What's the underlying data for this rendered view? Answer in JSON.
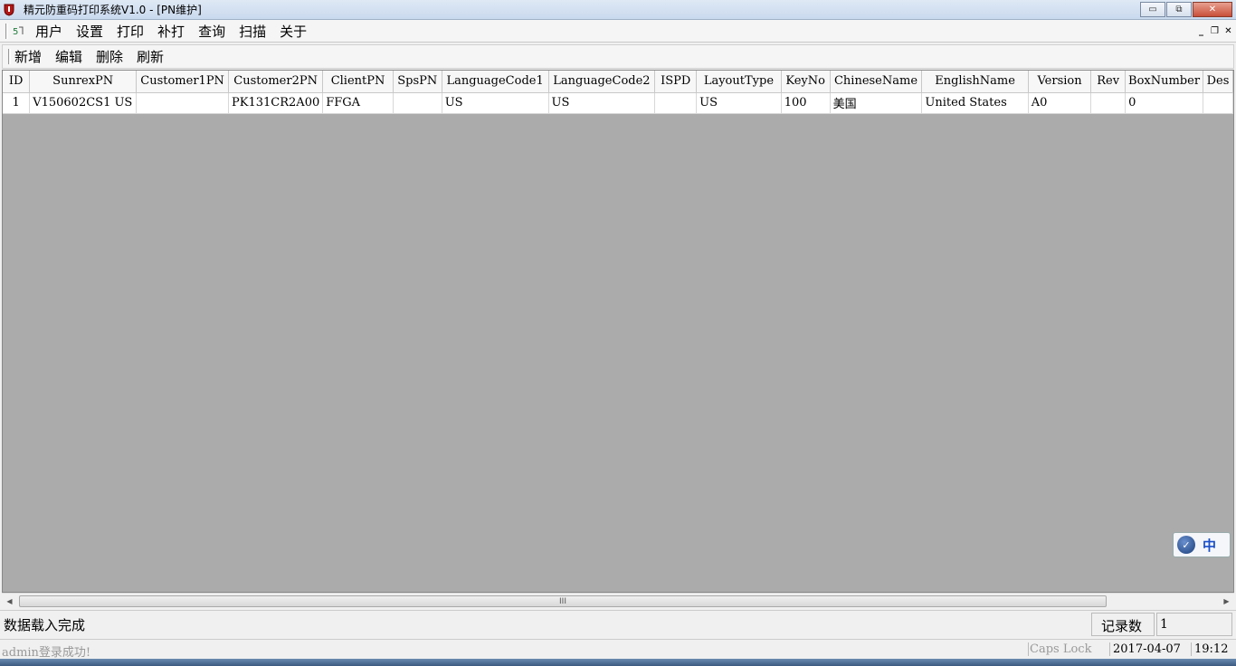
{
  "window": {
    "title": "精元防重码打印系统V1.0 - [PN维护]",
    "controls": {
      "minimize": "▭",
      "maximize": "⧉",
      "close": "✕"
    }
  },
  "menubar": {
    "items": [
      "用户",
      "设置",
      "打印",
      "补打",
      "查询",
      "扫描",
      "关于"
    ],
    "mdi_controls": {
      "minimize": "_",
      "restore": "❐",
      "close": "✕"
    }
  },
  "toolbar": {
    "items": [
      "新增",
      "编辑",
      "删除",
      "刷新"
    ]
  },
  "grid": {
    "columns": [
      "ID",
      "SunrexPN",
      "Customer1PN",
      "Customer2PN",
      "ClientPN",
      "SpsPN",
      "LanguageCode1",
      "LanguageCode2",
      "ISPD",
      "LayoutType",
      "KeyNo",
      "ChineseName",
      "EnglishName",
      "Version",
      "Rev",
      "BoxNumber",
      "Des"
    ],
    "rows": [
      [
        "1",
        "V150602CS1 US",
        "",
        "PK131CR2A00",
        "FFGA",
        "",
        "US",
        "US",
        "",
        "US",
        "100",
        "美国",
        "United States",
        "A0",
        "",
        "0",
        ""
      ]
    ]
  },
  "scrollbar": {
    "grip": "III",
    "left": "◀",
    "right": "▶"
  },
  "status": {
    "message": "数据载入完成",
    "record_label": "记录数",
    "record_count": "1",
    "login_message": "admin登录成功!",
    "caps_lock": "Caps Lock",
    "date": "2017-04-07",
    "time": "19:12"
  },
  "ime": {
    "label": "中"
  }
}
